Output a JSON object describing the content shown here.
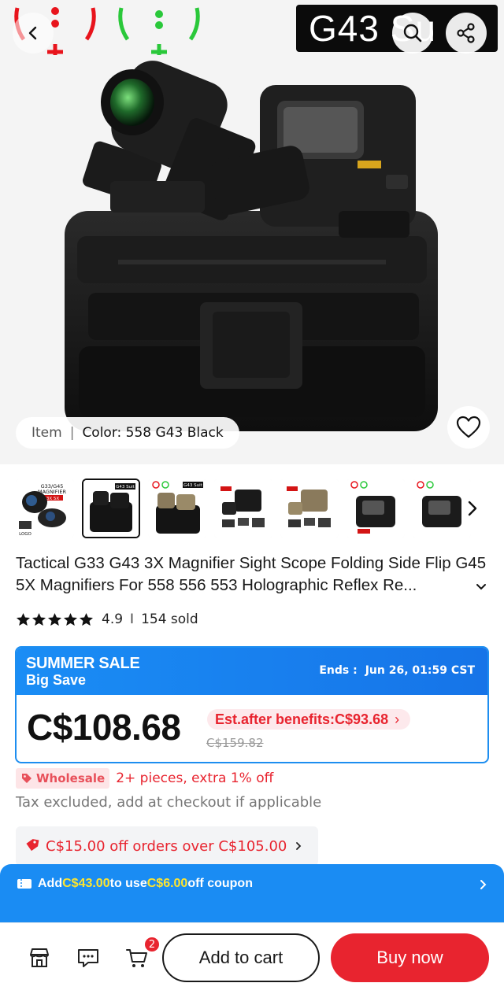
{
  "hero": {
    "banner_text": "G43 Su",
    "item_label": "Item",
    "separator": "|",
    "color_value": "Color: 558 G43 Black"
  },
  "thumbnails": {
    "count": 8,
    "selected_index": 1,
    "first_text": [
      "G33/G45",
      "MAGNIFIER",
      "3X 5X"
    ],
    "tag": "G43 Suit",
    "mini_logo": "LOGO"
  },
  "product": {
    "title": "Tactical  G33 G43 3X Magnifier Sight Scope Folding Side Flip G45 5X Magnifiers For 558 556 553 Holographic Reflex Re...",
    "rating": "4.9",
    "separator": "I",
    "sold": "154 sold",
    "stars": 5
  },
  "sale": {
    "title_line1": "SUMMER SALE",
    "title_line2": "Big Save",
    "ends_label": "Ends :",
    "ends_value": "Jun 26, 01:59 CST",
    "price": "C$108.68",
    "benefit": "Est.after benefits:C$93.68",
    "old_price": "C$159.82"
  },
  "wholesale": {
    "badge": "Wholesale",
    "text": "2+ pieces, extra 1% off"
  },
  "tax_note": "Tax excluded, add at checkout if applicable",
  "coupon": {
    "text": "C$15.00 off orders over C$105.00"
  },
  "promo_banner": {
    "part1": "Add ",
    "amount": "C$43.00",
    "part2": " to use ",
    "discount": "C$6.00",
    "part3": " off coupon"
  },
  "bottom_bar": {
    "cart_count": "2",
    "add_to_cart": "Add to cart",
    "buy_now": "Buy now"
  },
  "colors": {
    "accent_red": "#e8242f",
    "accent_blue": "#1a8cf3",
    "highlight_yellow": "#ffe52e"
  },
  "icons": [
    "back-arrow-icon",
    "search-icon",
    "share-icon",
    "heart-icon",
    "chevron-right-icon",
    "chevron-down-icon",
    "star-icon",
    "tag-icon",
    "coupon-ticket-icon",
    "store-icon",
    "chat-icon",
    "cart-icon"
  ]
}
